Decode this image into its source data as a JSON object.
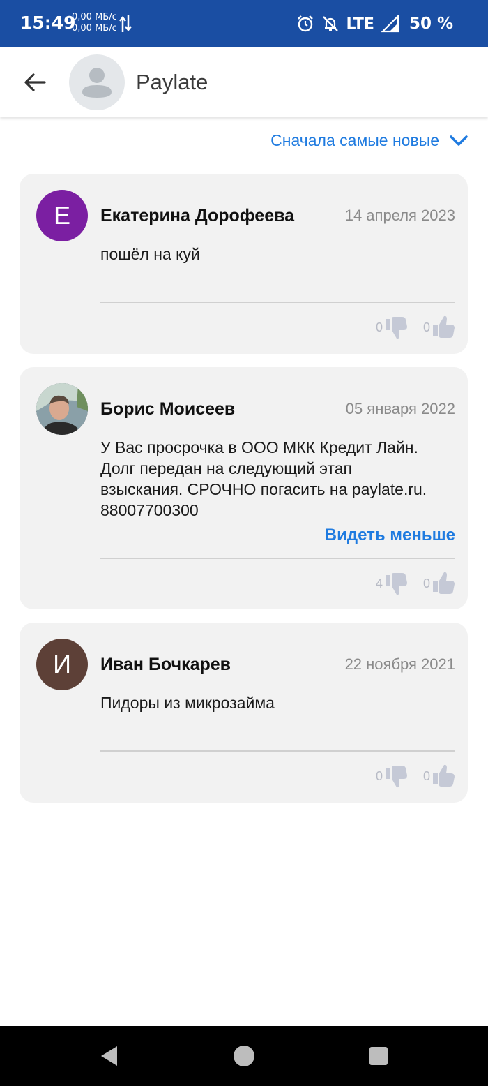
{
  "status_bar": {
    "time": "15:49",
    "speed_up": "0,00 МБ/с",
    "speed_down": "0,00 МБ/с",
    "network": "LTE",
    "battery": "50 %"
  },
  "header": {
    "title": "Paylate"
  },
  "sort": {
    "label": "Сначала самые новые"
  },
  "reviews": [
    {
      "author": "Екатерина Дорофеева",
      "date": "14 апреля 2023",
      "avatar_letter": "Е",
      "avatar_color": "#7b1fa2",
      "text": "пошёл на куй",
      "dislikes": "0",
      "likes": "0"
    },
    {
      "author": "Борис Моисеев",
      "date": "05 января 2022",
      "avatar_letter": "",
      "avatar_color": "#3b3b3b",
      "text": "У Вас просрочка в ООО МКК Кредит Лайн. Долг передан на следующий этап взыскания. СРОЧНО погасить на paylate.ru. 88007700300",
      "see_less": "Видеть меньше",
      "dislikes": "4",
      "likes": "0"
    },
    {
      "author": "Иван Бочкарев",
      "date": "22 ноября 2021",
      "avatar_letter": "И",
      "avatar_color": "#5d4037",
      "text": "Пидоры из микрозайма",
      "dislikes": "0",
      "likes": "0"
    }
  ],
  "colors": {
    "status_bar": "#1a4ea3",
    "accent": "#1f7be0",
    "card_bg": "#f2f2f2",
    "vote_icon": "#c5c9d6"
  }
}
